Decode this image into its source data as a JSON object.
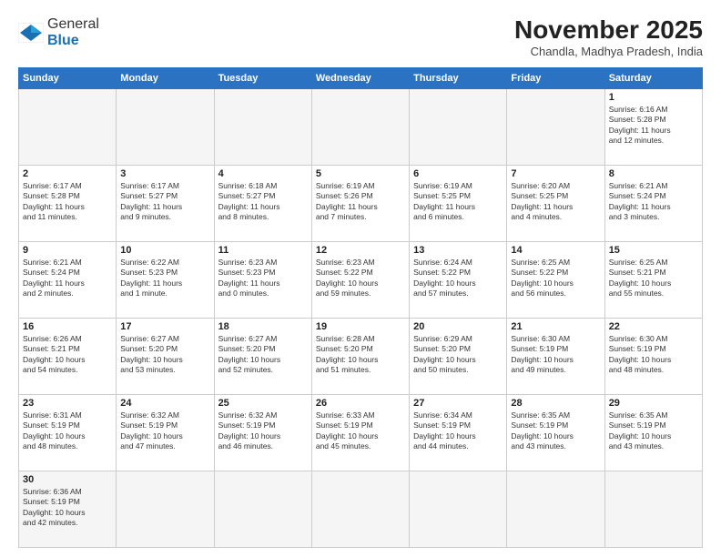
{
  "logo": {
    "general": "General",
    "blue": "Blue"
  },
  "header": {
    "month": "November 2025",
    "location": "Chandla, Madhya Pradesh, India"
  },
  "days_of_week": [
    "Sunday",
    "Monday",
    "Tuesday",
    "Wednesday",
    "Thursday",
    "Friday",
    "Saturday"
  ],
  "weeks": [
    [
      {
        "day": "",
        "info": ""
      },
      {
        "day": "",
        "info": ""
      },
      {
        "day": "",
        "info": ""
      },
      {
        "day": "",
        "info": ""
      },
      {
        "day": "",
        "info": ""
      },
      {
        "day": "",
        "info": ""
      },
      {
        "day": "1",
        "info": "Sunrise: 6:16 AM\nSunset: 5:28 PM\nDaylight: 11 hours\nand 12 minutes."
      }
    ],
    [
      {
        "day": "2",
        "info": "Sunrise: 6:17 AM\nSunset: 5:28 PM\nDaylight: 11 hours\nand 11 minutes."
      },
      {
        "day": "3",
        "info": "Sunrise: 6:17 AM\nSunset: 5:27 PM\nDaylight: 11 hours\nand 9 minutes."
      },
      {
        "day": "4",
        "info": "Sunrise: 6:18 AM\nSunset: 5:27 PM\nDaylight: 11 hours\nand 8 minutes."
      },
      {
        "day": "5",
        "info": "Sunrise: 6:19 AM\nSunset: 5:26 PM\nDaylight: 11 hours\nand 7 minutes."
      },
      {
        "day": "6",
        "info": "Sunrise: 6:19 AM\nSunset: 5:25 PM\nDaylight: 11 hours\nand 6 minutes."
      },
      {
        "day": "7",
        "info": "Sunrise: 6:20 AM\nSunset: 5:25 PM\nDaylight: 11 hours\nand 4 minutes."
      },
      {
        "day": "8",
        "info": "Sunrise: 6:21 AM\nSunset: 5:24 PM\nDaylight: 11 hours\nand 3 minutes."
      }
    ],
    [
      {
        "day": "9",
        "info": "Sunrise: 6:21 AM\nSunset: 5:24 PM\nDaylight: 11 hours\nand 2 minutes."
      },
      {
        "day": "10",
        "info": "Sunrise: 6:22 AM\nSunset: 5:23 PM\nDaylight: 11 hours\nand 1 minute."
      },
      {
        "day": "11",
        "info": "Sunrise: 6:23 AM\nSunset: 5:23 PM\nDaylight: 11 hours\nand 0 minutes."
      },
      {
        "day": "12",
        "info": "Sunrise: 6:23 AM\nSunset: 5:22 PM\nDaylight: 10 hours\nand 59 minutes."
      },
      {
        "day": "13",
        "info": "Sunrise: 6:24 AM\nSunset: 5:22 PM\nDaylight: 10 hours\nand 57 minutes."
      },
      {
        "day": "14",
        "info": "Sunrise: 6:25 AM\nSunset: 5:22 PM\nDaylight: 10 hours\nand 56 minutes."
      },
      {
        "day": "15",
        "info": "Sunrise: 6:25 AM\nSunset: 5:21 PM\nDaylight: 10 hours\nand 55 minutes."
      }
    ],
    [
      {
        "day": "16",
        "info": "Sunrise: 6:26 AM\nSunset: 5:21 PM\nDaylight: 10 hours\nand 54 minutes."
      },
      {
        "day": "17",
        "info": "Sunrise: 6:27 AM\nSunset: 5:20 PM\nDaylight: 10 hours\nand 53 minutes."
      },
      {
        "day": "18",
        "info": "Sunrise: 6:27 AM\nSunset: 5:20 PM\nDaylight: 10 hours\nand 52 minutes."
      },
      {
        "day": "19",
        "info": "Sunrise: 6:28 AM\nSunset: 5:20 PM\nDaylight: 10 hours\nand 51 minutes."
      },
      {
        "day": "20",
        "info": "Sunrise: 6:29 AM\nSunset: 5:20 PM\nDaylight: 10 hours\nand 50 minutes."
      },
      {
        "day": "21",
        "info": "Sunrise: 6:30 AM\nSunset: 5:19 PM\nDaylight: 10 hours\nand 49 minutes."
      },
      {
        "day": "22",
        "info": "Sunrise: 6:30 AM\nSunset: 5:19 PM\nDaylight: 10 hours\nand 48 minutes."
      }
    ],
    [
      {
        "day": "23",
        "info": "Sunrise: 6:31 AM\nSunset: 5:19 PM\nDaylight: 10 hours\nand 48 minutes."
      },
      {
        "day": "24",
        "info": "Sunrise: 6:32 AM\nSunset: 5:19 PM\nDaylight: 10 hours\nand 47 minutes."
      },
      {
        "day": "25",
        "info": "Sunrise: 6:32 AM\nSunset: 5:19 PM\nDaylight: 10 hours\nand 46 minutes."
      },
      {
        "day": "26",
        "info": "Sunrise: 6:33 AM\nSunset: 5:19 PM\nDaylight: 10 hours\nand 45 minutes."
      },
      {
        "day": "27",
        "info": "Sunrise: 6:34 AM\nSunset: 5:19 PM\nDaylight: 10 hours\nand 44 minutes."
      },
      {
        "day": "28",
        "info": "Sunrise: 6:35 AM\nSunset: 5:19 PM\nDaylight: 10 hours\nand 43 minutes."
      },
      {
        "day": "29",
        "info": "Sunrise: 6:35 AM\nSunset: 5:19 PM\nDaylight: 10 hours\nand 43 minutes."
      }
    ],
    [
      {
        "day": "30",
        "info": "Sunrise: 6:36 AM\nSunset: 5:19 PM\nDaylight: 10 hours\nand 42 minutes."
      },
      {
        "day": "",
        "info": ""
      },
      {
        "day": "",
        "info": ""
      },
      {
        "day": "",
        "info": ""
      },
      {
        "day": "",
        "info": ""
      },
      {
        "day": "",
        "info": ""
      },
      {
        "day": "",
        "info": ""
      }
    ]
  ]
}
